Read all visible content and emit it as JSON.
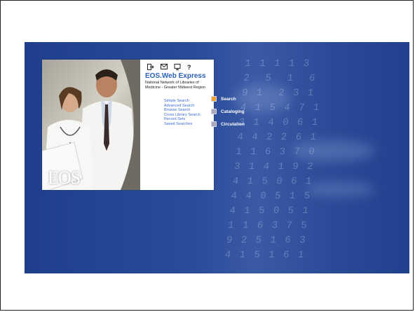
{
  "toolbar": {
    "icons": [
      "exit-icon",
      "mail-icon",
      "computer-icon",
      "help-icon"
    ],
    "help_glyph": "?"
  },
  "panel": {
    "title": "EOS.Web Express",
    "subtitle": "National Network of Libraries of Medicine - Greater Midwest Region",
    "logo_text": "EOS"
  },
  "links": [
    {
      "label": "Simple Search"
    },
    {
      "label": "Advanced Search"
    },
    {
      "label": "Browse Search"
    },
    {
      "label": "Cross Library Search"
    },
    {
      "label": "Record Sets"
    },
    {
      "label": "Saved Searches"
    }
  ],
  "menu": [
    {
      "label": "Search",
      "color": "#f0a030"
    },
    {
      "label": "Cataloging",
      "color": "#a8a8b8"
    },
    {
      "label": "Circulation",
      "color": "#a8a8b8"
    }
  ],
  "colors": {
    "banner": "#2a4a97",
    "accent": "#2c62b5"
  }
}
